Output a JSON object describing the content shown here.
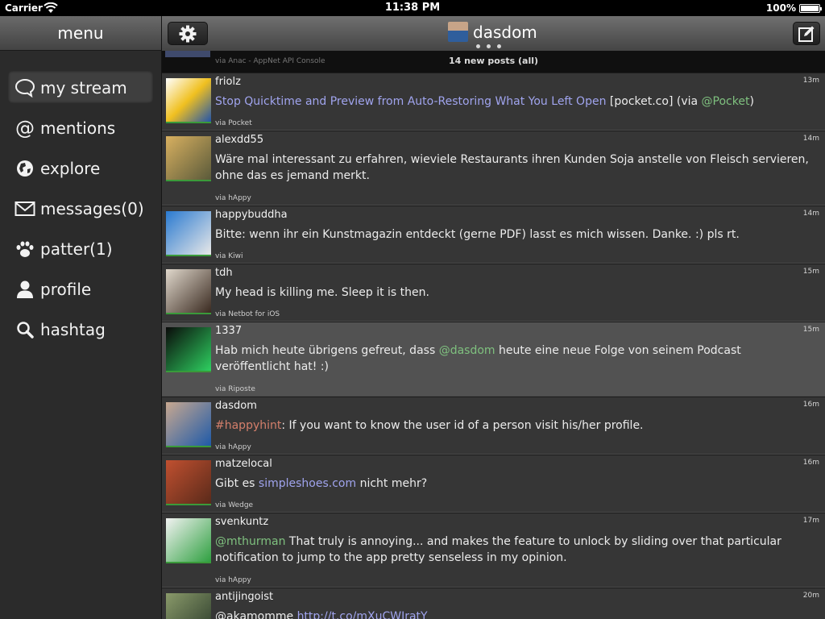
{
  "status_bar": {
    "carrier": "Carrier",
    "time": "11:38 PM",
    "battery": "100%",
    "battery_level": 1.0
  },
  "sidebar": {
    "title": "menu",
    "items": [
      {
        "label": "my stream",
        "icon": "speech-bubble-icon",
        "active": true
      },
      {
        "label": "mentions",
        "icon": "at-sign-icon"
      },
      {
        "label": "explore",
        "icon": "globe-icon"
      },
      {
        "label": "messages(0)",
        "icon": "envelope-icon"
      },
      {
        "label": "patter(1)",
        "icon": "paw-icon"
      },
      {
        "label": "profile",
        "icon": "person-icon"
      },
      {
        "label": "hashtag",
        "icon": "magnifier-icon"
      }
    ]
  },
  "header": {
    "username": "dasdom",
    "settings_icon": "gear-icon",
    "compose_icon": "compose-icon",
    "page_count": 3
  },
  "banner": {
    "new_posts": "14 new posts (all)",
    "partial_via": "via Anac - AppNet API Console"
  },
  "posts": [
    {
      "user": "friolz",
      "time": "13m",
      "via": "via Pocket",
      "avatar_colors": [
        "#ffffff",
        "#f0c020",
        "#2255aa"
      ],
      "segments": [
        {
          "t": "Stop Quicktime and Preview from Auto-Restoring What You Left Open",
          "c": "link"
        },
        {
          "t": " [pocket.co] (via ",
          "c": ""
        },
        {
          "t": "@Pocket",
          "c": "mention"
        },
        {
          "t": ")",
          "c": ""
        }
      ]
    },
    {
      "user": "alexdd55",
      "time": "14m",
      "via": "via hAppy",
      "avatar_colors": [
        "#d8b060",
        "#5a5a3a"
      ],
      "segments": [
        {
          "t": "Wäre mal interessant zu erfahren, wieviele Restaurants ihren Kunden Soja anstelle von Fleisch servieren, ohne das es jemand merkt.",
          "c": ""
        }
      ]
    },
    {
      "user": "happybuddha",
      "time": "14m",
      "via": "via Kiwi",
      "avatar_colors": [
        "#2a7ad0",
        "#e8e8e8"
      ],
      "segments": [
        {
          "t": "Bitte: wenn ihr ein Kunstmagazin entdeckt (gerne PDF) lasst es mich wissen. Danke. :) pls rt.",
          "c": ""
        }
      ]
    },
    {
      "user": "tdh",
      "time": "15m",
      "via": "via Netbot for iOS",
      "avatar_colors": [
        "#e0d8cc",
        "#3a2a20"
      ],
      "segments": [
        {
          "t": "My head is killing me. Sleep it is then.",
          "c": ""
        }
      ]
    },
    {
      "user": "1337",
      "time": "15m",
      "via": "via Riposte",
      "highlight": true,
      "avatar_colors": [
        "#0a0a0a",
        "#2ed060"
      ],
      "segments": [
        {
          "t": "Hab mich heute übrigens gefreut, dass ",
          "c": ""
        },
        {
          "t": "@dasdom",
          "c": "mention"
        },
        {
          "t": " heute eine neue Folge von seinem Podcast veröffentlicht hat! :)",
          "c": ""
        }
      ]
    },
    {
      "user": "dasdom",
      "time": "16m",
      "via": "via hAppy",
      "avatar_colors": [
        "#c8a890",
        "#1f5aa8"
      ],
      "segments": [
        {
          "t": "#happyhint",
          "c": "hashtag"
        },
        {
          "t": ": If you want to know the user id of a person visit his/her profile.",
          "c": ""
        }
      ]
    },
    {
      "user": "matzelocal",
      "time": "16m",
      "via": "via Wedge",
      "avatar_colors": [
        "#c05030",
        "#5a2a1a"
      ],
      "segments": [
        {
          "t": "Gibt es ",
          "c": ""
        },
        {
          "t": "simpleshoes.com",
          "c": "link"
        },
        {
          "t": " nicht mehr?",
          "c": ""
        }
      ]
    },
    {
      "user": "svenkuntz",
      "time": "17m",
      "via": "via hAppy",
      "avatar_colors": [
        "#f2f2f2",
        "#2fa040"
      ],
      "segments": [
        {
          "t": "@mthurman",
          "c": "mention"
        },
        {
          "t": " That truly is annoying... and makes the feature to unlock by sliding over that particular notification to jump to the app pretty senseless in my opinion.",
          "c": ""
        }
      ]
    },
    {
      "user": "antijingoist",
      "time": "20m",
      "via": "",
      "avatar_colors": [
        "#8a9a6a",
        "#2a3a2a"
      ],
      "segments": [
        {
          "t": "@akamomme ",
          "c": ""
        },
        {
          "t": "http://t.co/mXuCWIratY",
          "c": "link"
        }
      ]
    }
  ]
}
